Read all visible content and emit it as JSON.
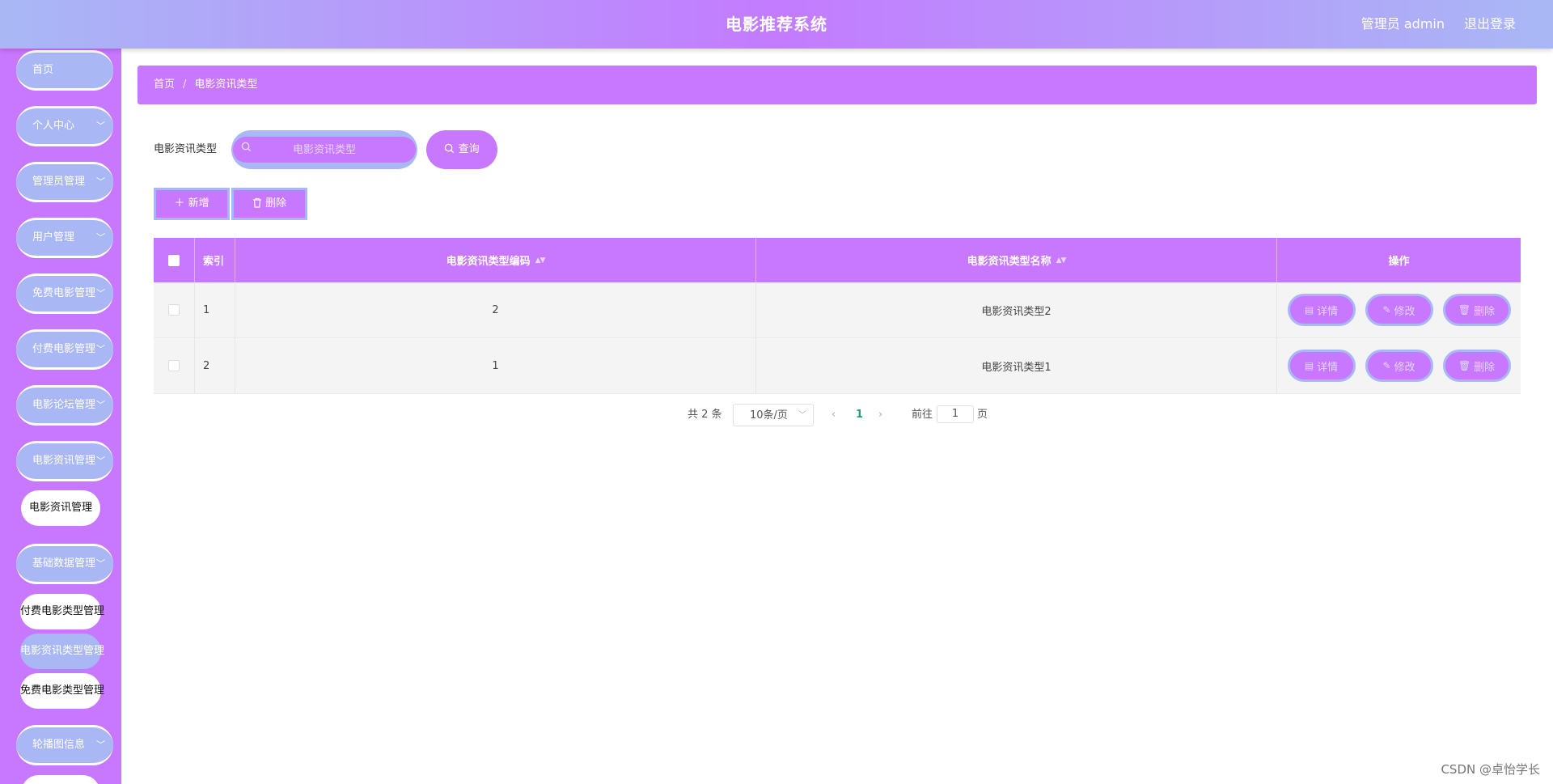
{
  "header": {
    "title": "电影推荐系统",
    "user": "管理员 admin",
    "logout": "退出登录"
  },
  "sidebar": {
    "items": [
      {
        "label": "首页",
        "chevron": ""
      },
      {
        "label": "个人中心",
        "chevron": "﹀"
      },
      {
        "label": "管理员管理",
        "chevron": "﹀"
      },
      {
        "label": "用户管理",
        "chevron": "﹀"
      },
      {
        "label": "免费电影管理",
        "chevron": "﹀"
      },
      {
        "label": "付费电影管理",
        "chevron": "﹀"
      },
      {
        "label": "电影论坛管理",
        "chevron": "﹀"
      },
      {
        "label": "电影资讯管理",
        "chevron": "﹀"
      },
      {
        "label": "基础数据管理",
        "chevron": "﹀"
      },
      {
        "label": "轮播图信息",
        "chevron": "﹀"
      }
    ],
    "sub_news": "电影资讯管理",
    "sub_basic": [
      "付费电影类型管理",
      "电影资讯类型管理",
      "免费电影类型管理"
    ]
  },
  "breadcrumb": {
    "home": "首页",
    "separator": "/",
    "current": "电影资讯类型"
  },
  "search": {
    "label": "电影资讯类型",
    "placeholder": "电影资讯类型",
    "icon": "search-icon",
    "button": "查询"
  },
  "actions": {
    "add": "新增",
    "delete": "删除"
  },
  "table": {
    "columns": [
      "索引",
      "电影资讯类型编码",
      "电影资讯类型名称",
      "操作"
    ],
    "rows": [
      {
        "index": "1",
        "code": "2",
        "name": "电影资讯类型2"
      },
      {
        "index": "2",
        "code": "1",
        "name": "电影资讯类型1"
      }
    ],
    "row_actions": {
      "detail": "详情",
      "edit": "修改",
      "delete": "删除"
    }
  },
  "pagination": {
    "total": "共 2 条",
    "page_size": "10条/页",
    "current": "1",
    "goto": "前往",
    "goto_value": "1",
    "page_unit": "页"
  },
  "watermark": "CSDN @卓怡学长",
  "colors": {
    "accent": "#c877ff",
    "secondary": "#a9b8f5",
    "active_page": "#1aa27f"
  }
}
